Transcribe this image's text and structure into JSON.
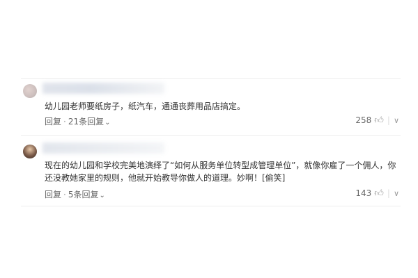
{
  "comments": [
    {
      "text": "幼儿园老师要纸房子，纸汽车，通通丧葬用品店搞定。",
      "reply_label": "回复",
      "replies_label": "21条回复",
      "likes": "258"
    },
    {
      "text": "现在的幼儿园和学校完美地演绎了“如何从服务单位转型成管理单位”，就像你雇了一个佣人，你还没教她家里的规则，他就开始教导你做人的道理。妙啊！[偷笑]",
      "reply_label": "回复",
      "replies_label": "5条回复",
      "likes": "143"
    }
  ],
  "icons": {
    "like": "thumbs-up-icon",
    "more": "chevron-down-icon",
    "replies_toggle": "chevron-down-icon"
  },
  "colors": {
    "text": "#333333",
    "meta": "#666666",
    "divider": "#ececec"
  }
}
